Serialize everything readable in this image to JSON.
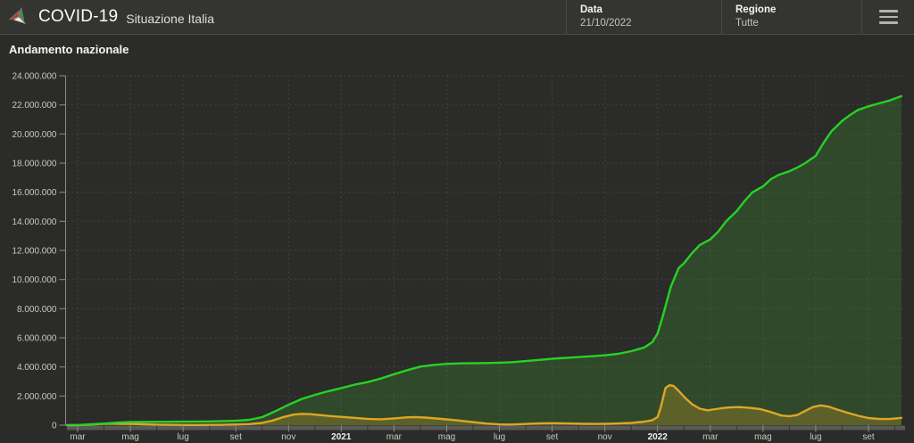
{
  "header": {
    "app_title": "COVID-19",
    "app_subtitle": "Situazione Italia",
    "filters": [
      {
        "label": "Data",
        "value": "21/10/2022"
      },
      {
        "label": "Regione",
        "value": "Tutte"
      }
    ],
    "menu_icon": "hamburger-icon",
    "logo_icon": "italy-tricolor-pinwheel-icon"
  },
  "chart": {
    "title": "Andamento nazionale"
  },
  "colors": {
    "header_bg": "#343431",
    "page_bg": "#2b2b29",
    "green_line": "#27d127",
    "green_fill": "rgba(62,150,48,0.28)",
    "yellow_line": "#dfa525",
    "yellow_fill": "rgba(223,173,40,0.25)"
  },
  "chart_data": {
    "type": "area",
    "title": "Andamento nazionale",
    "grid": true,
    "legend": false,
    "x_axis": {
      "unit": "months (0 = mar 2020)",
      "range_months": [
        -0.4,
        31.3
      ],
      "ticks": [
        {
          "m": 0,
          "label": "mar"
        },
        {
          "m": 2,
          "label": "mag"
        },
        {
          "m": 4,
          "label": "lug"
        },
        {
          "m": 6,
          "label": "set"
        },
        {
          "m": 8,
          "label": "nov"
        },
        {
          "m": 10,
          "label": "2021",
          "bold": true
        },
        {
          "m": 12,
          "label": "mar"
        },
        {
          "m": 14,
          "label": "mag"
        },
        {
          "m": 16,
          "label": "lug"
        },
        {
          "m": 18,
          "label": "set"
        },
        {
          "m": 20,
          "label": "nov"
        },
        {
          "m": 22,
          "label": "2022",
          "bold": true
        },
        {
          "m": 24,
          "label": "mar"
        },
        {
          "m": 26,
          "label": "mag"
        },
        {
          "m": 28,
          "label": "lug"
        },
        {
          "m": 30,
          "label": "set"
        }
      ]
    },
    "y_axis": {
      "min": 0,
      "max": 24000000,
      "step": 2000000,
      "tick_labels": [
        "0",
        "2.000.000",
        "4.000.000",
        "6.000.000",
        "8.000.000",
        "10.000.000",
        "12.000.000",
        "14.000.000",
        "16.000.000",
        "18.000.000",
        "20.000.000",
        "22.000.000",
        "24.000.000"
      ]
    },
    "series": [
      {
        "name": "cumulative-total-green",
        "color": "#27d127",
        "fill": "rgba(62,150,48,0.28)",
        "points": [
          [
            -0.4,
            2000
          ],
          [
            0,
            10000
          ],
          [
            0.5,
            60000
          ],
          [
            1,
            110000
          ],
          [
            1.5,
            180000
          ],
          [
            2,
            215000
          ],
          [
            2.5,
            228000
          ],
          [
            3,
            234000
          ],
          [
            4,
            241000
          ],
          [
            5,
            256000
          ],
          [
            6,
            302000
          ],
          [
            6.5,
            365000
          ],
          [
            7,
            550000
          ],
          [
            7.5,
            960000
          ],
          [
            8,
            1400000
          ],
          [
            8.5,
            1800000
          ],
          [
            9,
            2080000
          ],
          [
            9.5,
            2330000
          ],
          [
            10,
            2550000
          ],
          [
            10.5,
            2780000
          ],
          [
            11,
            2960000
          ],
          [
            11.5,
            3200000
          ],
          [
            12,
            3500000
          ],
          [
            12.5,
            3780000
          ],
          [
            13,
            4020000
          ],
          [
            13.5,
            4140000
          ],
          [
            14,
            4210000
          ],
          [
            14.5,
            4240000
          ],
          [
            15,
            4258000
          ],
          [
            15.5,
            4270000
          ],
          [
            16,
            4290000
          ],
          [
            16.5,
            4330000
          ],
          [
            17,
            4400000
          ],
          [
            17.5,
            4480000
          ],
          [
            18,
            4560000
          ],
          [
            18.5,
            4620000
          ],
          [
            19,
            4680000
          ],
          [
            19.5,
            4730000
          ],
          [
            20,
            4800000
          ],
          [
            20.5,
            4900000
          ],
          [
            21,
            5080000
          ],
          [
            21.5,
            5340000
          ],
          [
            21.8,
            5700000
          ],
          [
            22,
            6300000
          ],
          [
            22.2,
            7500000
          ],
          [
            22.5,
            9500000
          ],
          [
            22.8,
            10800000
          ],
          [
            23,
            11120000
          ],
          [
            23.3,
            11800000
          ],
          [
            23.6,
            12380000
          ],
          [
            24,
            12760000
          ],
          [
            24.3,
            13300000
          ],
          [
            24.6,
            14000000
          ],
          [
            25,
            14700000
          ],
          [
            25.3,
            15400000
          ],
          [
            25.6,
            16000000
          ],
          [
            26,
            16400000
          ],
          [
            26.3,
            16900000
          ],
          [
            26.6,
            17200000
          ],
          [
            27,
            17440000
          ],
          [
            27.3,
            17700000
          ],
          [
            27.6,
            18000000
          ],
          [
            28,
            18500000
          ],
          [
            28.3,
            19400000
          ],
          [
            28.6,
            20200000
          ],
          [
            29,
            20900000
          ],
          [
            29.3,
            21300000
          ],
          [
            29.6,
            21650000
          ],
          [
            30,
            21900000
          ],
          [
            30.4,
            22100000
          ],
          [
            30.8,
            22300000
          ],
          [
            31.25,
            22600000
          ]
        ]
      },
      {
        "name": "currently-positive-yellow",
        "color": "#dfa525",
        "fill": "rgba(223,173,40,0.25)",
        "points": [
          [
            -0.4,
            1500
          ],
          [
            0,
            8000
          ],
          [
            0.5,
            35000
          ],
          [
            1,
            96000
          ],
          [
            1.3,
            108000
          ],
          [
            1.6,
            101000
          ],
          [
            2,
            83000
          ],
          [
            2.5,
            60000
          ],
          [
            3,
            39000
          ],
          [
            3.5,
            25000
          ],
          [
            4,
            13500
          ],
          [
            4.5,
            12500
          ],
          [
            5,
            16000
          ],
          [
            5.5,
            27000
          ],
          [
            6,
            46000
          ],
          [
            6.5,
            75000
          ],
          [
            7,
            160000
          ],
          [
            7.4,
            320000
          ],
          [
            7.8,
            560000
          ],
          [
            8.2,
            730000
          ],
          [
            8.5,
            780000
          ],
          [
            8.8,
            760000
          ],
          [
            9.2,
            690000
          ],
          [
            9.6,
            625000
          ],
          [
            10,
            570000
          ],
          [
            10.5,
            500000
          ],
          [
            11,
            434000
          ],
          [
            11.5,
            405000
          ],
          [
            12,
            465000
          ],
          [
            12.5,
            540000
          ],
          [
            12.8,
            558000
          ],
          [
            13.2,
            520000
          ],
          [
            13.6,
            460000
          ],
          [
            14,
            400000
          ],
          [
            14.5,
            310000
          ],
          [
            15,
            210000
          ],
          [
            15.5,
            110000
          ],
          [
            16,
            57000
          ],
          [
            16.4,
            44000
          ],
          [
            16.8,
            65000
          ],
          [
            17.2,
            105000
          ],
          [
            17.6,
            130000
          ],
          [
            18,
            136000
          ],
          [
            18.4,
            128000
          ],
          [
            18.8,
            108000
          ],
          [
            19.2,
            92000
          ],
          [
            19.6,
            83000
          ],
          [
            20,
            90000
          ],
          [
            20.5,
            115000
          ],
          [
            21,
            155000
          ],
          [
            21.5,
            245000
          ],
          [
            21.8,
            340000
          ],
          [
            22,
            560000
          ],
          [
            22.1,
            1100000
          ],
          [
            22.2,
            1800000
          ],
          [
            22.3,
            2550000
          ],
          [
            22.45,
            2740000
          ],
          [
            22.6,
            2700000
          ],
          [
            22.8,
            2350000
          ],
          [
            23,
            1950000
          ],
          [
            23.3,
            1450000
          ],
          [
            23.6,
            1130000
          ],
          [
            23.9,
            1020000
          ],
          [
            24.2,
            1100000
          ],
          [
            24.5,
            1180000
          ],
          [
            24.8,
            1230000
          ],
          [
            25.1,
            1240000
          ],
          [
            25.5,
            1190000
          ],
          [
            25.9,
            1100000
          ],
          [
            26.3,
            900000
          ],
          [
            26.7,
            660000
          ],
          [
            27,
            620000
          ],
          [
            27.3,
            700000
          ],
          [
            27.6,
            980000
          ],
          [
            27.9,
            1250000
          ],
          [
            28.2,
            1360000
          ],
          [
            28.5,
            1270000
          ],
          [
            28.8,
            1080000
          ],
          [
            29.2,
            860000
          ],
          [
            29.6,
            650000
          ],
          [
            30,
            490000
          ],
          [
            30.4,
            430000
          ],
          [
            30.8,
            425000
          ],
          [
            31.25,
            500000
          ]
        ]
      }
    ]
  }
}
